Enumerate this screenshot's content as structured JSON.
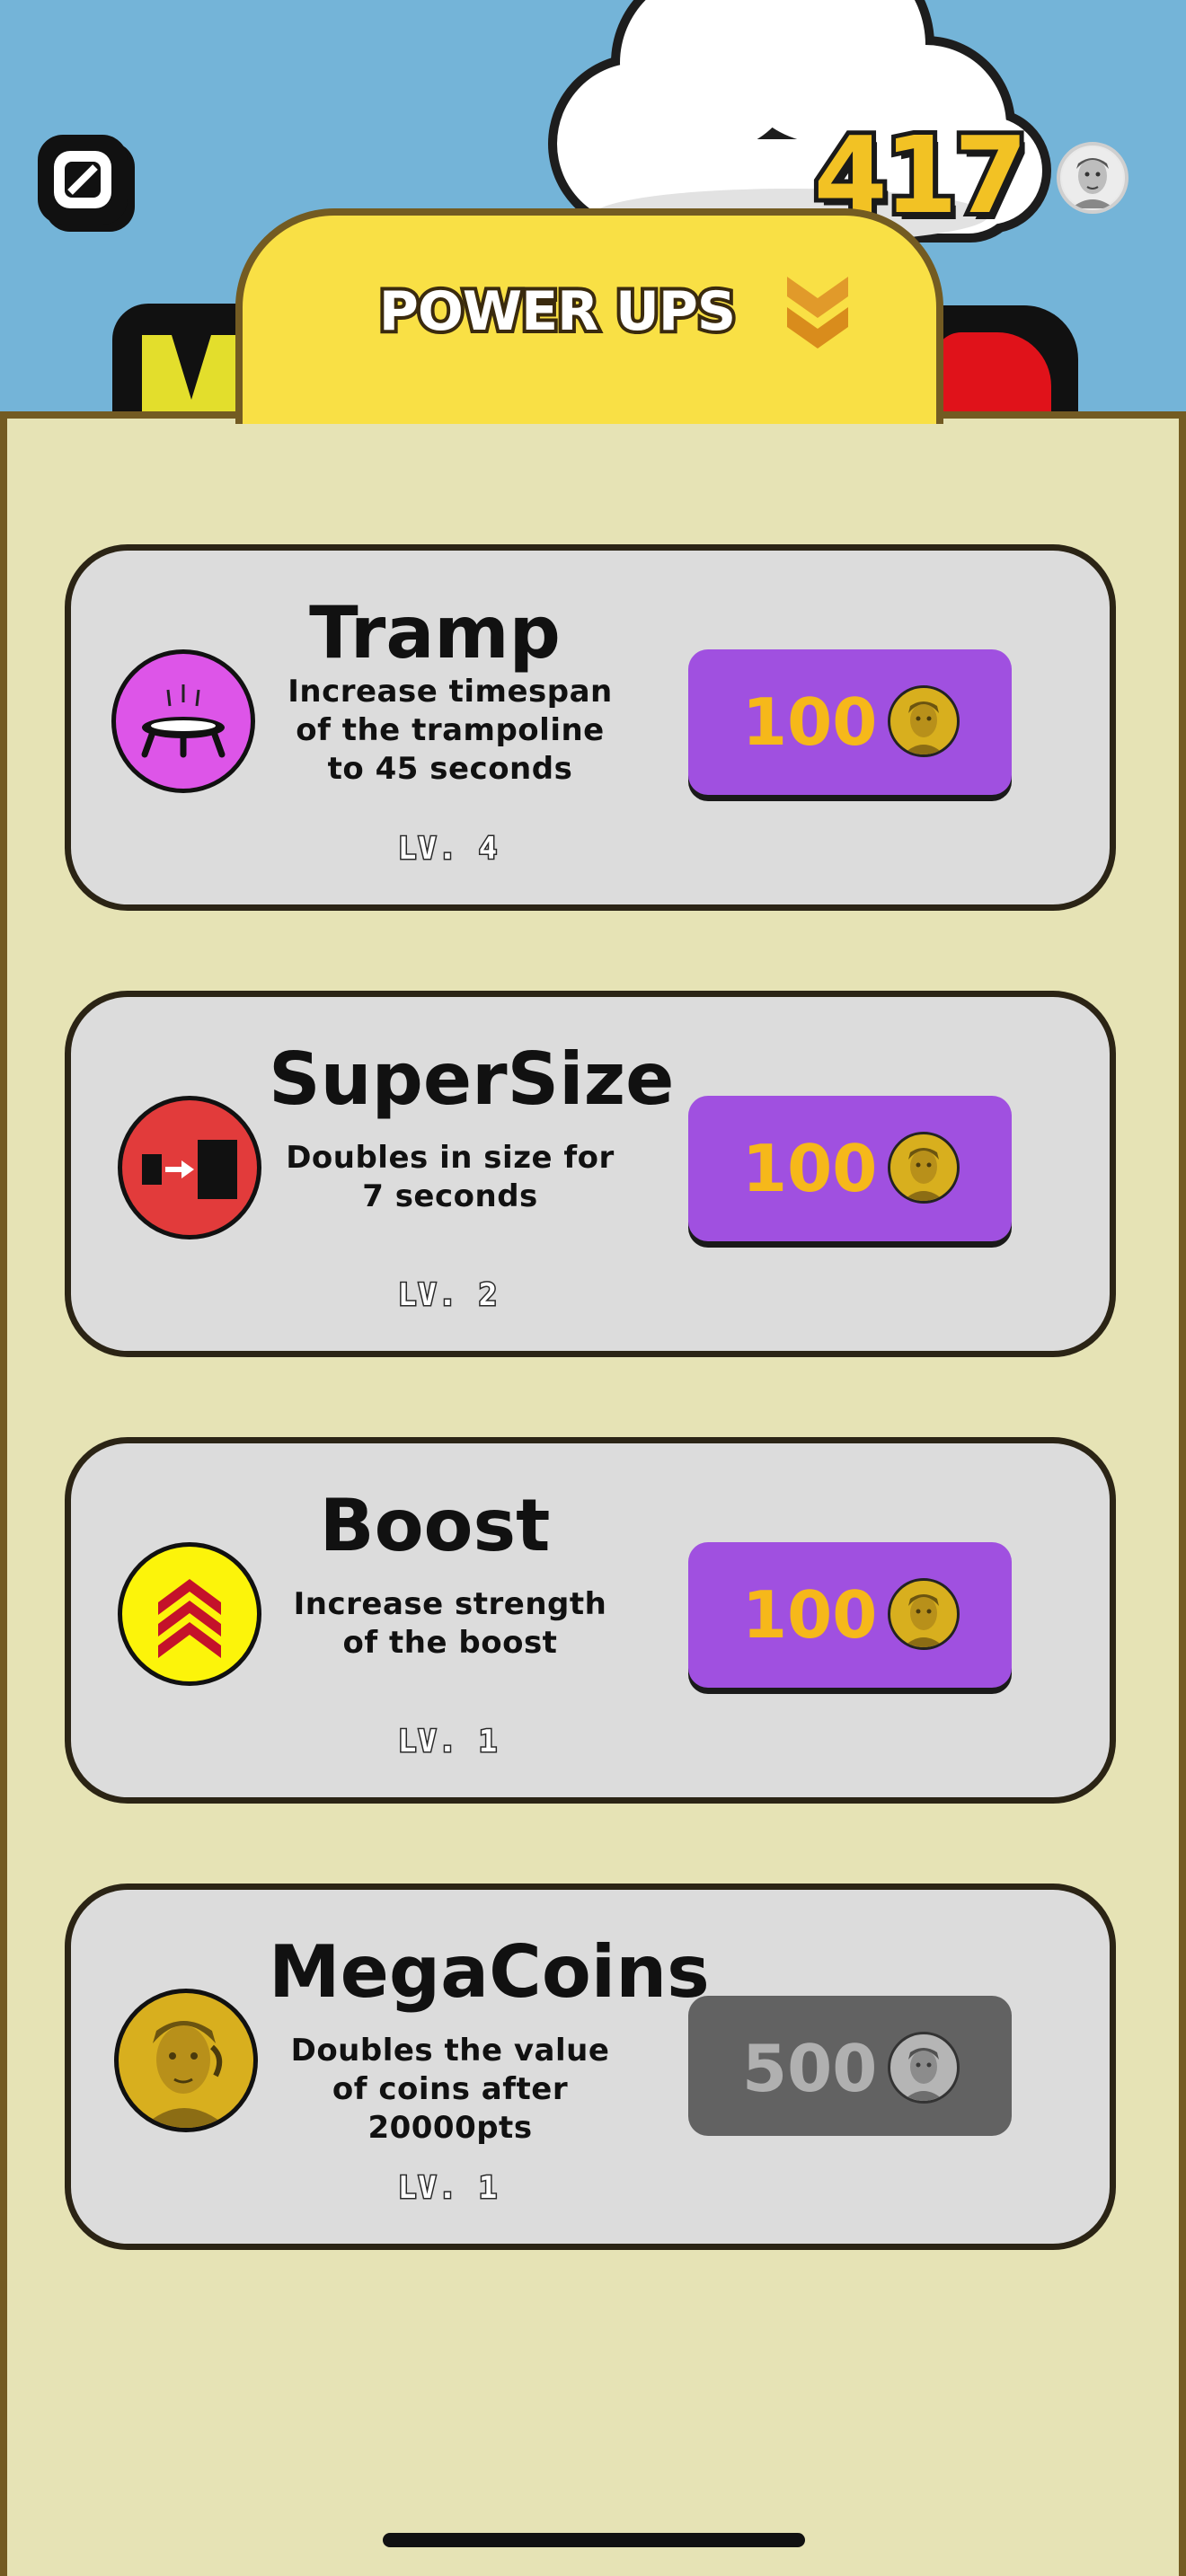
{
  "header": {
    "coin_count": "417",
    "tab_title": "POWER UPS",
    "pause_icon": "pause-icon",
    "currency_icon": "face-coin-icon",
    "collapse_icon": "double-chevron-down-icon"
  },
  "powerups": [
    {
      "name": "Tramp",
      "description": "Increase timespan of the trampoline to 45 seconds",
      "level": "LV. 4",
      "price": "100",
      "icon": "trampoline-icon",
      "icon_color": "#dd55e8",
      "enabled": true
    },
    {
      "name": "SuperSize",
      "description": "Doubles in size for  7 seconds",
      "level": "LV. 2",
      "price": "100",
      "icon": "supersize-icon",
      "icon_color": "#e23b3b",
      "enabled": true
    },
    {
      "name": "Boost",
      "description": "Increase strength of the boost",
      "level": "LV. 1",
      "price": "100",
      "icon": "boost-chevrons-icon",
      "icon_color": "#fcf40a",
      "enabled": true
    },
    {
      "name": "MegaCoins",
      "description": "Doubles the value of coins after 20000pts",
      "level": "LV. 1",
      "price": "500",
      "icon": "megacoin-icon",
      "icon_color": "#d8af1e",
      "enabled": false
    }
  ],
  "colors": {
    "sky": "#74b4d8",
    "panel": "#e6e3b5",
    "panel_border": "#735b22",
    "tab": "#f9e045",
    "buy_button": "#a050e0",
    "buy_button_disabled": "#626262",
    "price_text": "#f6b81a"
  }
}
